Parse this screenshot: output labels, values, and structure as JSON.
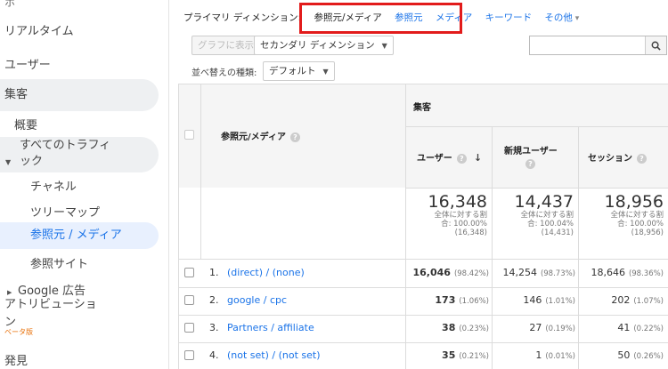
{
  "sidebar": {
    "top_cut": "ホ",
    "items": [
      {
        "label": "リアルタイム"
      },
      {
        "label": "ユーザー"
      },
      {
        "label": "集客"
      },
      {
        "label": "概要"
      },
      {
        "label": "すべてのトラフィ"
      },
      {
        "label": "ック"
      },
      {
        "label": "チャネル"
      },
      {
        "label": "ツリーマップ"
      },
      {
        "label": "参照元 / メディア"
      },
      {
        "label": "参照サイト"
      },
      {
        "label": "Google 広告"
      },
      {
        "label": "アトリビューショ"
      },
      {
        "label": "ン"
      },
      {
        "label": "発見"
      }
    ],
    "beta": "ベータ版"
  },
  "dimension_bar": {
    "label": "プライマリ ディメンション:",
    "active": "参照元/メディア",
    "links": [
      "参照元",
      "メディア",
      "キーワード",
      "その他"
    ]
  },
  "toolbar": {
    "chart_button": "グラフに表示",
    "secondary_dimension": "セカンダリ ディメンション",
    "sort_type_label": "並べ替えの種類:",
    "sort_type_value": "デフォルト",
    "search_placeholder": ""
  },
  "table": {
    "group_header": "集客",
    "dimension_header": "参照元/メディア",
    "columns": [
      "ユーザー",
      "新規ユーザー",
      "セッション"
    ],
    "totals": [
      {
        "value": "16,348",
        "line1": "全体に対する割",
        "line2": "合: 100.00%",
        "line3": "(16,348)"
      },
      {
        "value": "14,437",
        "line1": "全体に対する割",
        "line2": "合: 100.04%",
        "line3": "(14,431)"
      },
      {
        "value": "18,956",
        "line1": "全体に対する割",
        "line2": "合: 100.00%",
        "line3": "(18,956)"
      }
    ],
    "rows": [
      {
        "num": "1.",
        "name": "(direct) / (none)",
        "users": "16,046",
        "users_pct": "(98.42%)",
        "new_users": "14,254",
        "new_users_pct": "(98.73%)",
        "sessions": "18,646",
        "sessions_pct": "(98.36%)"
      },
      {
        "num": "2.",
        "name": "google / cpc",
        "users": "173",
        "users_pct": "(1.06%)",
        "new_users": "146",
        "new_users_pct": "(1.01%)",
        "sessions": "202",
        "sessions_pct": "(1.07%)"
      },
      {
        "num": "3.",
        "name": "Partners / affiliate",
        "users": "38",
        "users_pct": "(0.23%)",
        "new_users": "27",
        "new_users_pct": "(0.19%)",
        "sessions": "41",
        "sessions_pct": "(0.22%)"
      },
      {
        "num": "4.",
        "name": "(not set) / (not set)",
        "users": "35",
        "users_pct": "(0.21%)",
        "new_users": "1",
        "new_users_pct": "(0.01%)",
        "sessions": "50",
        "sessions_pct": "(0.26%)"
      }
    ]
  },
  "colors": {
    "accent": "#1a73e8",
    "highlight_box": "#e21b1b",
    "beta": "#e8710a"
  }
}
